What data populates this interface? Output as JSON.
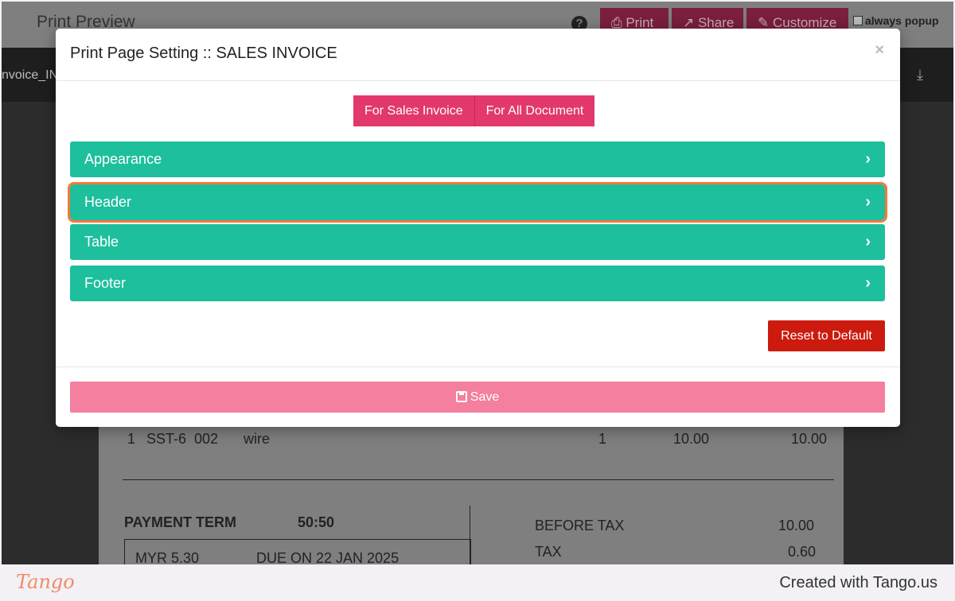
{
  "background": {
    "title": "Print Preview",
    "buttons": {
      "print": "Print",
      "share": "Share",
      "customize": "Customize"
    },
    "always_popup": "always popup",
    "file_label": "nvoice_IN",
    "invoice": {
      "line_item": {
        "no": "1",
        "code": "SST-6",
        "sub": "002",
        "desc": "wire",
        "qty": "1",
        "price": "10.00",
        "amount": "10.00"
      },
      "payment_term_label": "PAYMENT TERM",
      "payment_term_value": "50:50",
      "installment_amount": "MYR 5.30",
      "installment_due": "DUE ON 22 JAN 2025",
      "before_tax_label": "BEFORE TAX",
      "before_tax_value": "10.00",
      "tax_label": "TAX",
      "tax_value": "0.60"
    }
  },
  "modal": {
    "title": "Print Page Setting :: SALES INVOICE",
    "close": "×",
    "tabs": [
      "For Sales Invoice",
      "For All Document"
    ],
    "sections": [
      "Appearance",
      "Header",
      "Table",
      "Footer"
    ],
    "highlighted_section": "Header",
    "reset_label": "Reset to Default",
    "save_label": "Save"
  },
  "colors": {
    "section": "#1dbf9c",
    "tab": "#e2386c",
    "reset": "#cc1a0f",
    "save": "#f47f9e",
    "highlight": "#f27a3a"
  },
  "footer": {
    "logo": "Tango",
    "credit": "Created with Tango.us"
  }
}
